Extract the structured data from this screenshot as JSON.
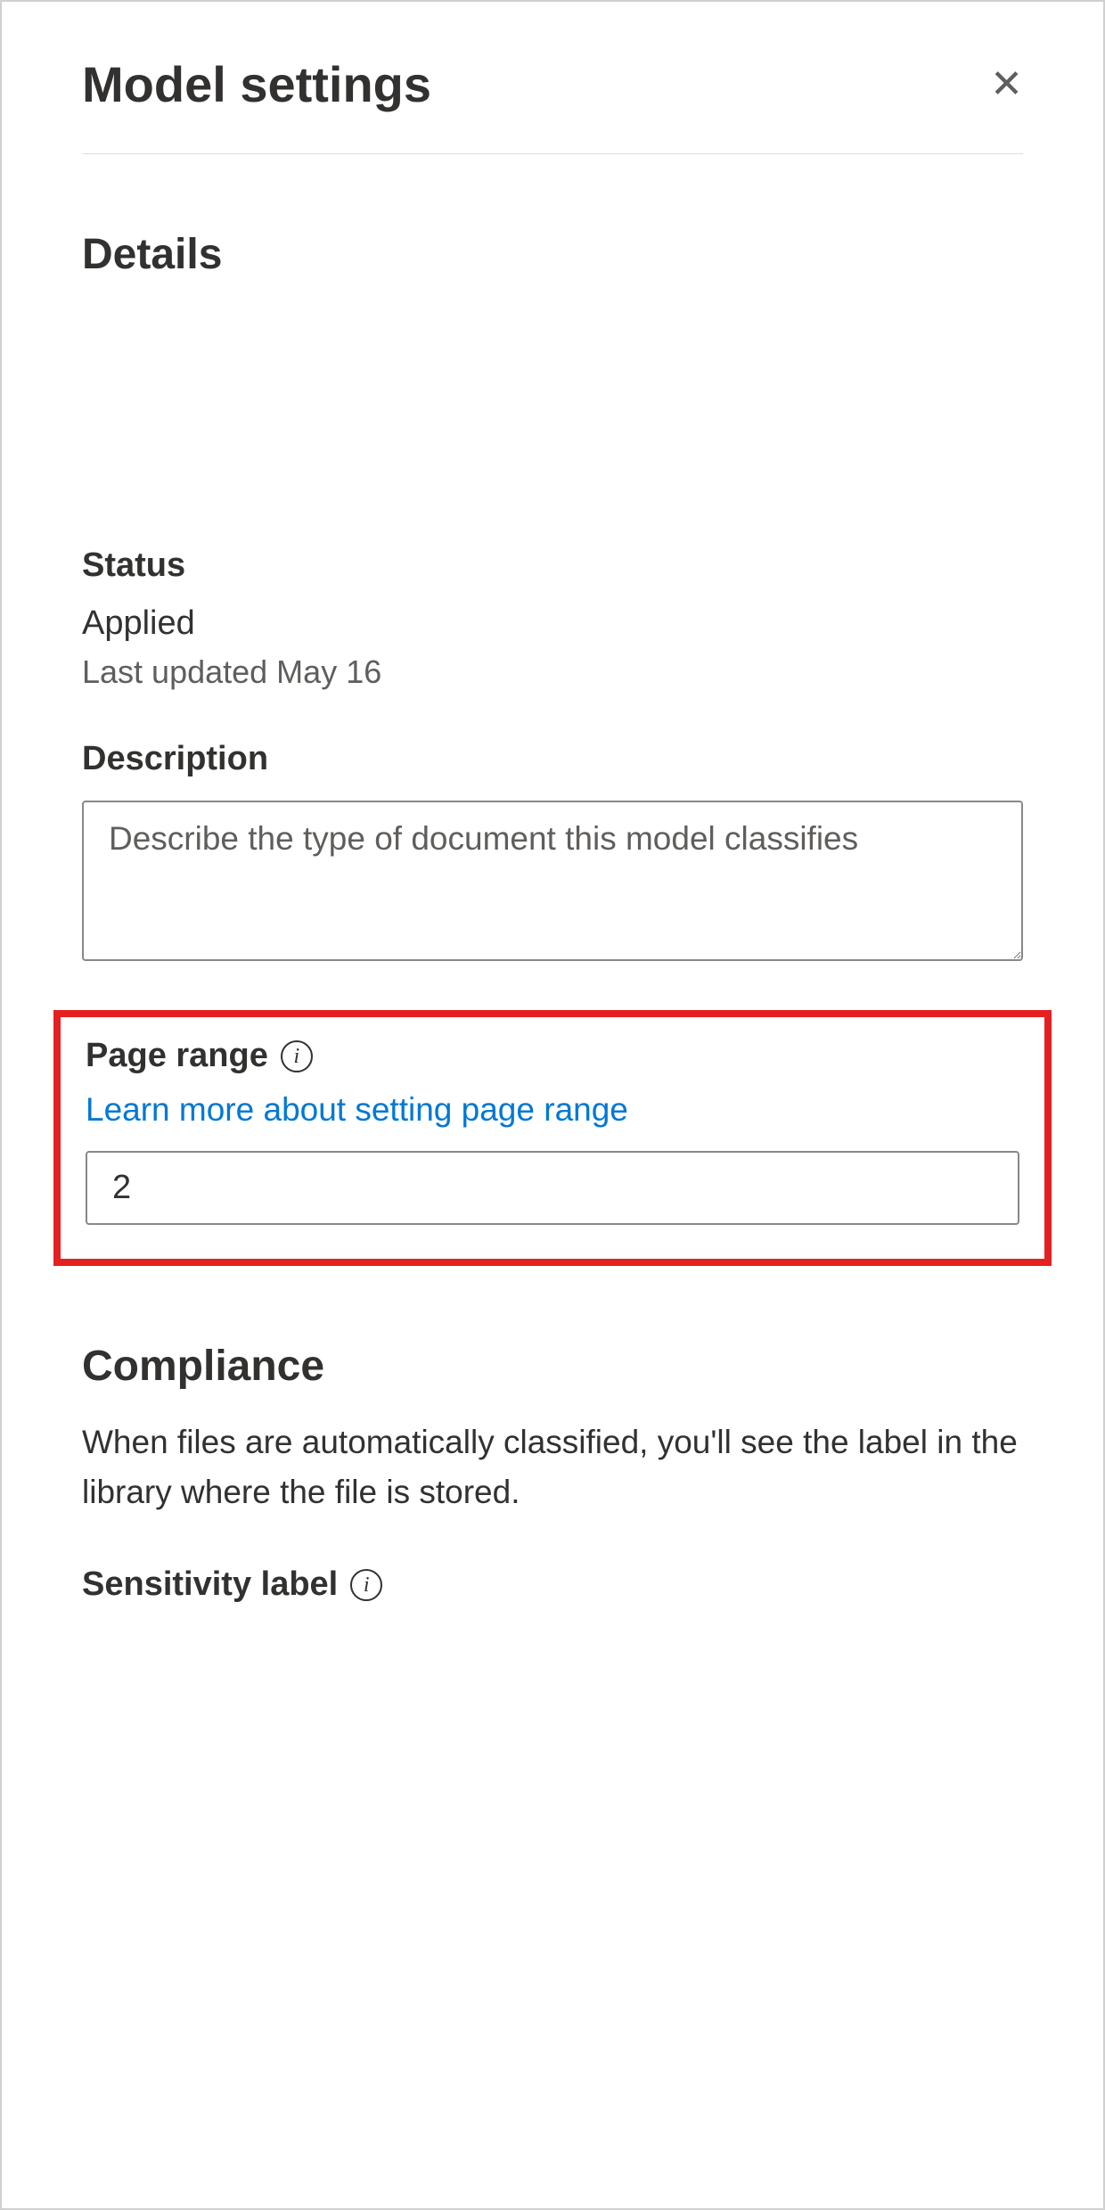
{
  "panel": {
    "title": "Model settings"
  },
  "details": {
    "heading": "Details",
    "status": {
      "label": "Status",
      "value": "Applied",
      "sub": "Last updated May 16"
    },
    "description": {
      "label": "Description",
      "placeholder": "Describe the type of document this model classifies",
      "value": ""
    },
    "page_range": {
      "label": "Page range",
      "link_text": "Learn more about setting page range",
      "value": "2"
    }
  },
  "compliance": {
    "heading": "Compliance",
    "description": "When files are automatically classified, you'll see the label in the library where the file is stored.",
    "sensitivity": {
      "label": "Sensitivity label"
    }
  }
}
